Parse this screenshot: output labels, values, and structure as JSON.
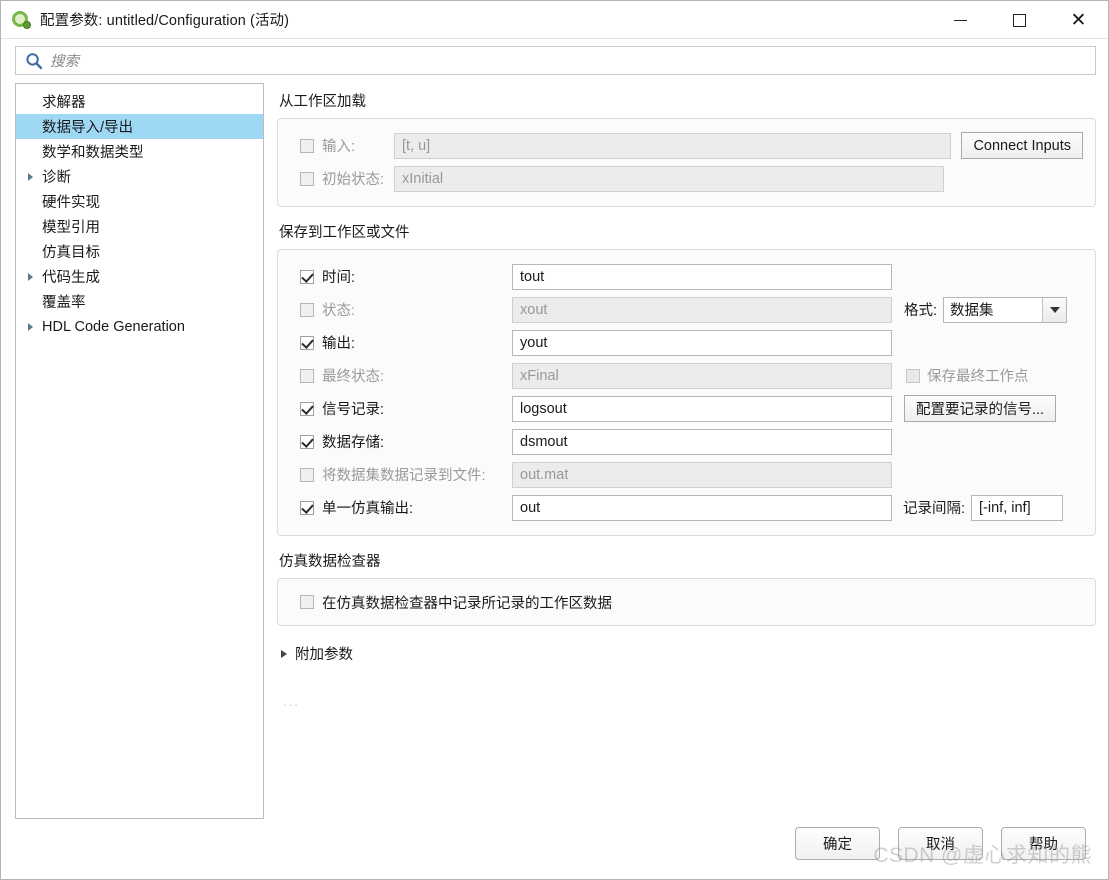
{
  "window": {
    "title": "配置参数: untitled/Configuration (活动)",
    "icon": "simulink-icon",
    "controls": {
      "minimize": "—",
      "maximize": "☐",
      "close": "✕"
    }
  },
  "search": {
    "placeholder": "搜索",
    "value": "",
    "icon": "search-icon"
  },
  "sidebar": {
    "items": [
      {
        "label": "求解器",
        "expandable": false,
        "selected": false
      },
      {
        "label": "数据导入/导出",
        "expandable": false,
        "selected": true
      },
      {
        "label": "数学和数据类型",
        "expandable": false,
        "selected": false
      },
      {
        "label": "诊断",
        "expandable": true,
        "selected": false
      },
      {
        "label": "硬件实现",
        "expandable": false,
        "selected": false
      },
      {
        "label": "模型引用",
        "expandable": false,
        "selected": false
      },
      {
        "label": "仿真目标",
        "expandable": false,
        "selected": false
      },
      {
        "label": "代码生成",
        "expandable": true,
        "selected": false
      },
      {
        "label": "覆盖率",
        "expandable": false,
        "selected": false
      },
      {
        "label": "HDL Code Generation",
        "expandable": true,
        "selected": false
      }
    ]
  },
  "load_section": {
    "title": "从工作区加载",
    "rows": [
      {
        "label": "输入:",
        "checked": false,
        "value": "[t, u]",
        "enabled": false
      },
      {
        "label": "初始状态:",
        "checked": false,
        "value": "xInitial",
        "enabled": false
      }
    ],
    "connect_inputs_button": "Connect Inputs"
  },
  "save_section": {
    "title": "保存到工作区或文件",
    "rows": [
      {
        "label": "时间:",
        "checked": true,
        "value": "tout",
        "enabled": true
      },
      {
        "label": "状态:",
        "checked": false,
        "value": "xout",
        "enabled": false
      },
      {
        "label": "输出:",
        "checked": true,
        "value": "yout",
        "enabled": true
      },
      {
        "label": "最终状态:",
        "checked": false,
        "value": "xFinal",
        "enabled": false
      },
      {
        "label": "信号记录:",
        "checked": true,
        "value": "logsout",
        "enabled": true
      },
      {
        "label": "数据存储:",
        "checked": true,
        "value": "dsmout",
        "enabled": true
      },
      {
        "label": "将数据集数据记录到文件:",
        "checked": false,
        "value": "out.mat",
        "enabled": false
      },
      {
        "label": "单一仿真输出:",
        "checked": true,
        "value": "out",
        "enabled": true
      }
    ],
    "format_label": "格式:",
    "format_value": "数据集",
    "save_final_op_point_label": "保存最终工作点",
    "save_final_op_point_checked": false,
    "configure_signals_button": "配置要记录的信号...",
    "log_interval_label": "记录间隔:",
    "log_interval_value": "[-inf, inf]"
  },
  "inspector_section": {
    "title": "仿真数据检查器",
    "checkbox_label": "在仿真数据检查器中记录所记录的工作区数据",
    "checked": false
  },
  "extra_params": {
    "label": "附加参数",
    "expanded": false
  },
  "ellipsis": "...",
  "footer": {
    "ok": "确定",
    "cancel": "取消",
    "help": "帮助"
  },
  "watermark": "CSDN @虚心求知的熊",
  "colors": {
    "selection": "#9fd8f4",
    "accent_icon": "#7ab648",
    "search_icon": "#3f6ea5"
  }
}
